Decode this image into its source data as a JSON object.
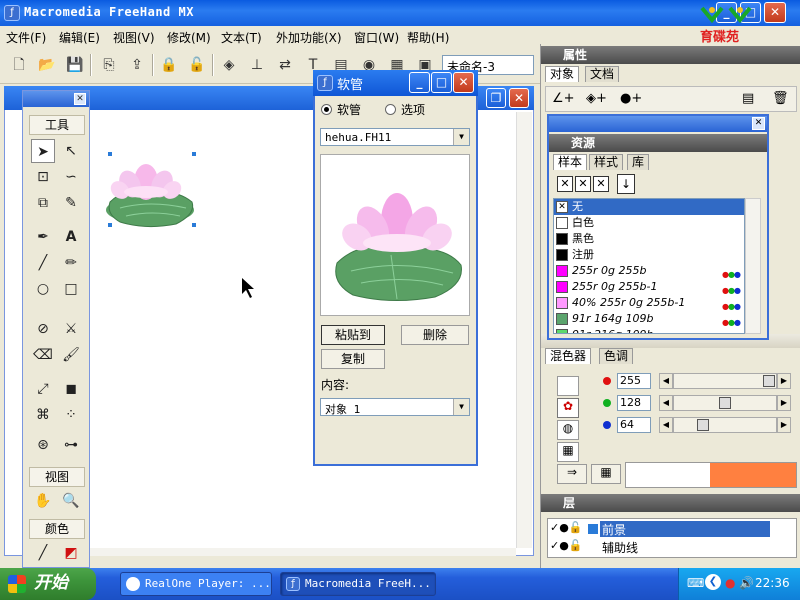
{
  "app": {
    "title": "Macromedia FreeHand MX",
    "brand_text": "育碟苑"
  },
  "menu": [
    "文件(F)",
    "编辑(E)",
    "视图(V)",
    "修改(M)",
    "文本(T)",
    "外加功能(X)",
    "窗口(W)",
    "帮助(H)"
  ],
  "toolbar": {
    "document_name": "未命名-3"
  },
  "tools_panel": {
    "section_tools": "工具",
    "section_view": "视图",
    "section_color": "颜色"
  },
  "hose_dialog": {
    "title": "软管",
    "radio_hose": "软管",
    "radio_options": "选项",
    "file_select": "hehua.FH11",
    "paste_button": "粘贴到",
    "delete_button": "删除",
    "copy_button": "复制",
    "content_label": "内容:",
    "content_select": "对象 1"
  },
  "properties_panel": {
    "title": "属性",
    "tabs": [
      "对象",
      "文档"
    ]
  },
  "assets_panel": {
    "title": "资源",
    "tabs": [
      "样本",
      "样式",
      "库"
    ],
    "swatches": [
      {
        "name": "无",
        "color": "#ffffff",
        "selected": true,
        "italic": false,
        "rgb_dots": false
      },
      {
        "name": "白色",
        "color": "#ffffff",
        "selected": false,
        "italic": false,
        "rgb_dots": false
      },
      {
        "name": "黑色",
        "color": "#000000",
        "selected": false,
        "italic": false,
        "rgb_dots": false
      },
      {
        "name": "注册",
        "color": "#000000",
        "selected": false,
        "italic": false,
        "rgb_dots": false
      },
      {
        "name": "255r 0g 255b",
        "color": "#ff00ff",
        "selected": false,
        "italic": true,
        "rgb_dots": true
      },
      {
        "name": "255r 0g 255b-1",
        "color": "#ff00ff",
        "selected": false,
        "italic": true,
        "rgb_dots": true
      },
      {
        "name": "40% 255r 0g 255b-1",
        "color": "#ff99ff",
        "selected": false,
        "italic": true,
        "rgb_dots": true
      },
      {
        "name": "91r 164g 109b",
        "color": "#5ba46d",
        "selected": false,
        "italic": true,
        "rgb_dots": true
      },
      {
        "name": "91r 216g 109b",
        "color": "#5bd86d",
        "selected": false,
        "italic": true,
        "rgb_dots": true
      }
    ]
  },
  "mixer_panel": {
    "tabs": [
      "混色器",
      "色调"
    ],
    "red": "255",
    "green": "128",
    "blue": "64",
    "red_fraction": 1.0,
    "green_fraction": 0.5,
    "blue_fraction": 0.25,
    "preview_color": "#ff8040"
  },
  "layers_panel": {
    "title": "层",
    "layers": [
      "前景",
      "辅助线"
    ]
  },
  "taskbar": {
    "start_label": "开始",
    "tasks": [
      "RealOne Player: ...",
      "Macromedia FreeH..."
    ],
    "clock": "22:36"
  }
}
